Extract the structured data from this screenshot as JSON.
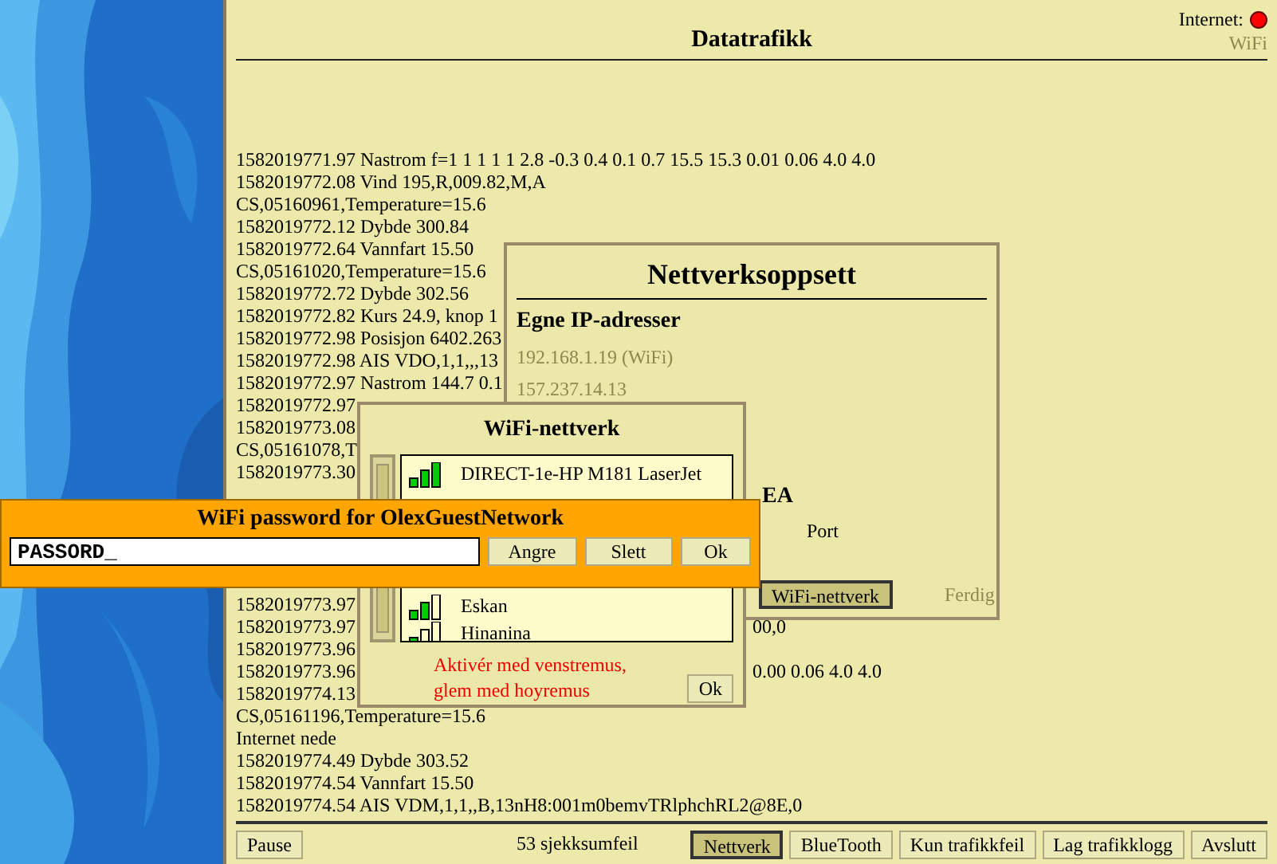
{
  "header": {
    "title": "Datatrafikk",
    "internet": {
      "label": "Internet:",
      "connected": false
    },
    "wifi": {
      "label": "WiFi",
      "active": false
    }
  },
  "log_top": [
    {
      "text": "1582019771.97 Nastrom f=1 1 1 1 1 2.8 -0.3 0.4 0.1 0.7 15.5 15.3 0.01 0.06 4.0 4.0"
    },
    {
      "text": "1582019772.08 Vind 195,R,009.82,M,A"
    },
    {
      "text": "CS,05160961,Temperature=15.6"
    },
    {
      "text": "1582019772.12 Dybde 300.84"
    },
    {
      "text": "1582019772.64 Vannfart 15.50"
    },
    {
      "text": "CS,05161020,Temperature=15.6"
    },
    {
      "text": "1582019772.72 Dybde 302.56"
    },
    {
      "text": "1582019772.82 Kurs 24.9, knop 1"
    },
    {
      "text": "1582019772.98 Posisjon 6402.263"
    },
    {
      "text": "1582019772.98 AIS VDO,1,1,,,13"
    },
    {
      "text": "1582019772.97 Nastrom 144.7 0.1"
    },
    {
      "text": "1582019772.97"
    },
    {
      "text": "1582019773.08"
    },
    {
      "text": "CS,05161078,T"
    },
    {
      "text": "1582019773.30"
    }
  ],
  "log_bottom": [
    {
      "text": "1582019773.97"
    },
    {
      "text": "1582019773.97",
      "tail": "00,0"
    },
    {
      "text": "1582019773.96"
    },
    {
      "text": "1582019773.96",
      "tail": "0.00 0.06 4.0 4.0"
    },
    {
      "text": "1582019774.13"
    },
    {
      "text": "CS,05161196,Temperature=15.6"
    },
    {
      "text": "Internet nede"
    },
    {
      "text": "1582019774.49 Dybde 303.52"
    },
    {
      "text": "1582019774.54 Vannfart 15.50"
    },
    {
      "text": "1582019774.54 AIS VDM,1,1,,B,13nH8:001m0bemvTRlphchRL2@8E,0"
    }
  ],
  "footer": {
    "pause": "Pause",
    "status": "53 sjekksumfeil",
    "buttons": [
      {
        "label": "Nettverk",
        "selected": true
      },
      {
        "label": "BlueTooth",
        "selected": false
      },
      {
        "label": "Kun trafikkfeil",
        "selected": false
      },
      {
        "label": "Lag trafikklogg",
        "selected": false
      },
      {
        "label": "Avslutt",
        "selected": false
      }
    ]
  },
  "network_dialog": {
    "title": "Nettverksoppsett",
    "section": "Egne IP-adresser",
    "addresses": [
      "192.168.1.19 (WiFi)",
      "157.237.14.13"
    ],
    "section_2": "EA",
    "column": "Port",
    "buttons": [
      {
        "label": "WiFi-nettverk",
        "selected": true,
        "disabled": false
      },
      {
        "label": "Ferdig",
        "selected": false,
        "disabled": true
      }
    ]
  },
  "wifi_dialog": {
    "title": "WiFi-nettverk",
    "networks": [
      {
        "name": "DIRECT-1e-HP M181 LaserJet",
        "kind": "strong"
      },
      {
        "name": "Eskan",
        "kind": "medium"
      },
      {
        "name": "Hinanina",
        "kind": "weak"
      }
    ],
    "hint_lines": [
      "Aktivér med venstremus,",
      "glem med hoyremus"
    ],
    "ok": "Ok"
  },
  "password_dialog": {
    "title": "WiFi password for OlexGuestNetwork",
    "value": "PASSORD_",
    "buttons": [
      "Angre",
      "Slett",
      "Ok"
    ]
  }
}
